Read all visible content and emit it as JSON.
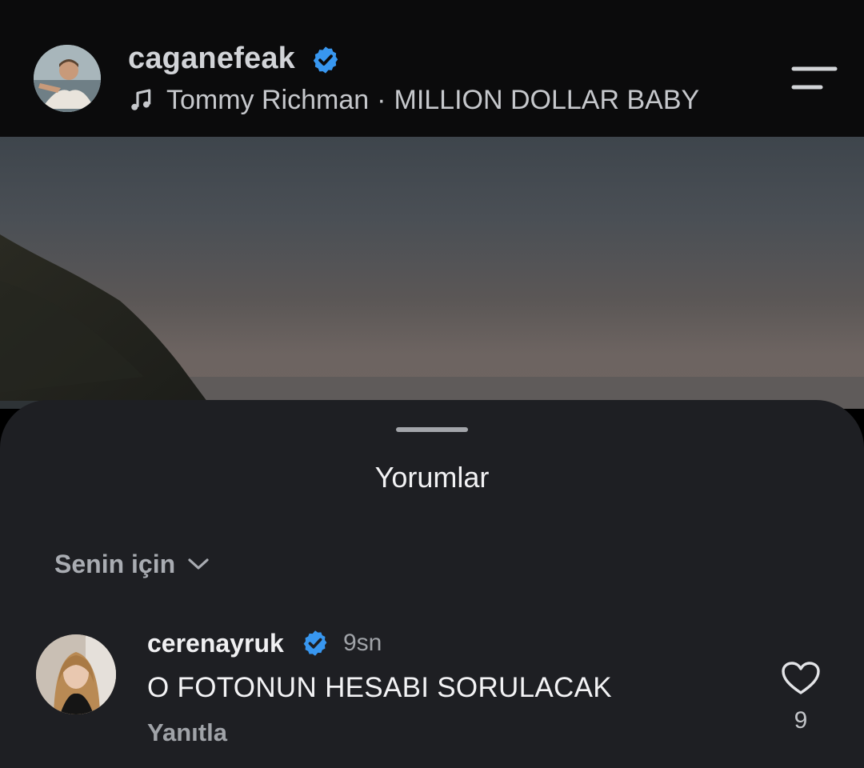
{
  "colors": {
    "verified": "#3897f0",
    "sheet_bg": "#1e1f23",
    "header_bg": "#0b0b0c"
  },
  "header": {
    "username": "caganefeak",
    "verified": true,
    "music": {
      "icon": "music-note-icon",
      "artist": "Tommy Richman",
      "separator": "·",
      "song": "MILLION DOLLAR BABY"
    },
    "menu_icon": "menu-icon"
  },
  "comments_sheet": {
    "title": "Yorumlar",
    "sort": {
      "label": "Senin için",
      "icon": "chevron-down-icon"
    },
    "comments": [
      {
        "username": "cerenayruk",
        "verified": true,
        "time": "9sn",
        "text": "O FOTONUN HESABI SORULACAK",
        "reply_label": "Yanıtla",
        "like_icon": "heart-outline-icon",
        "likes": "9"
      }
    ]
  }
}
